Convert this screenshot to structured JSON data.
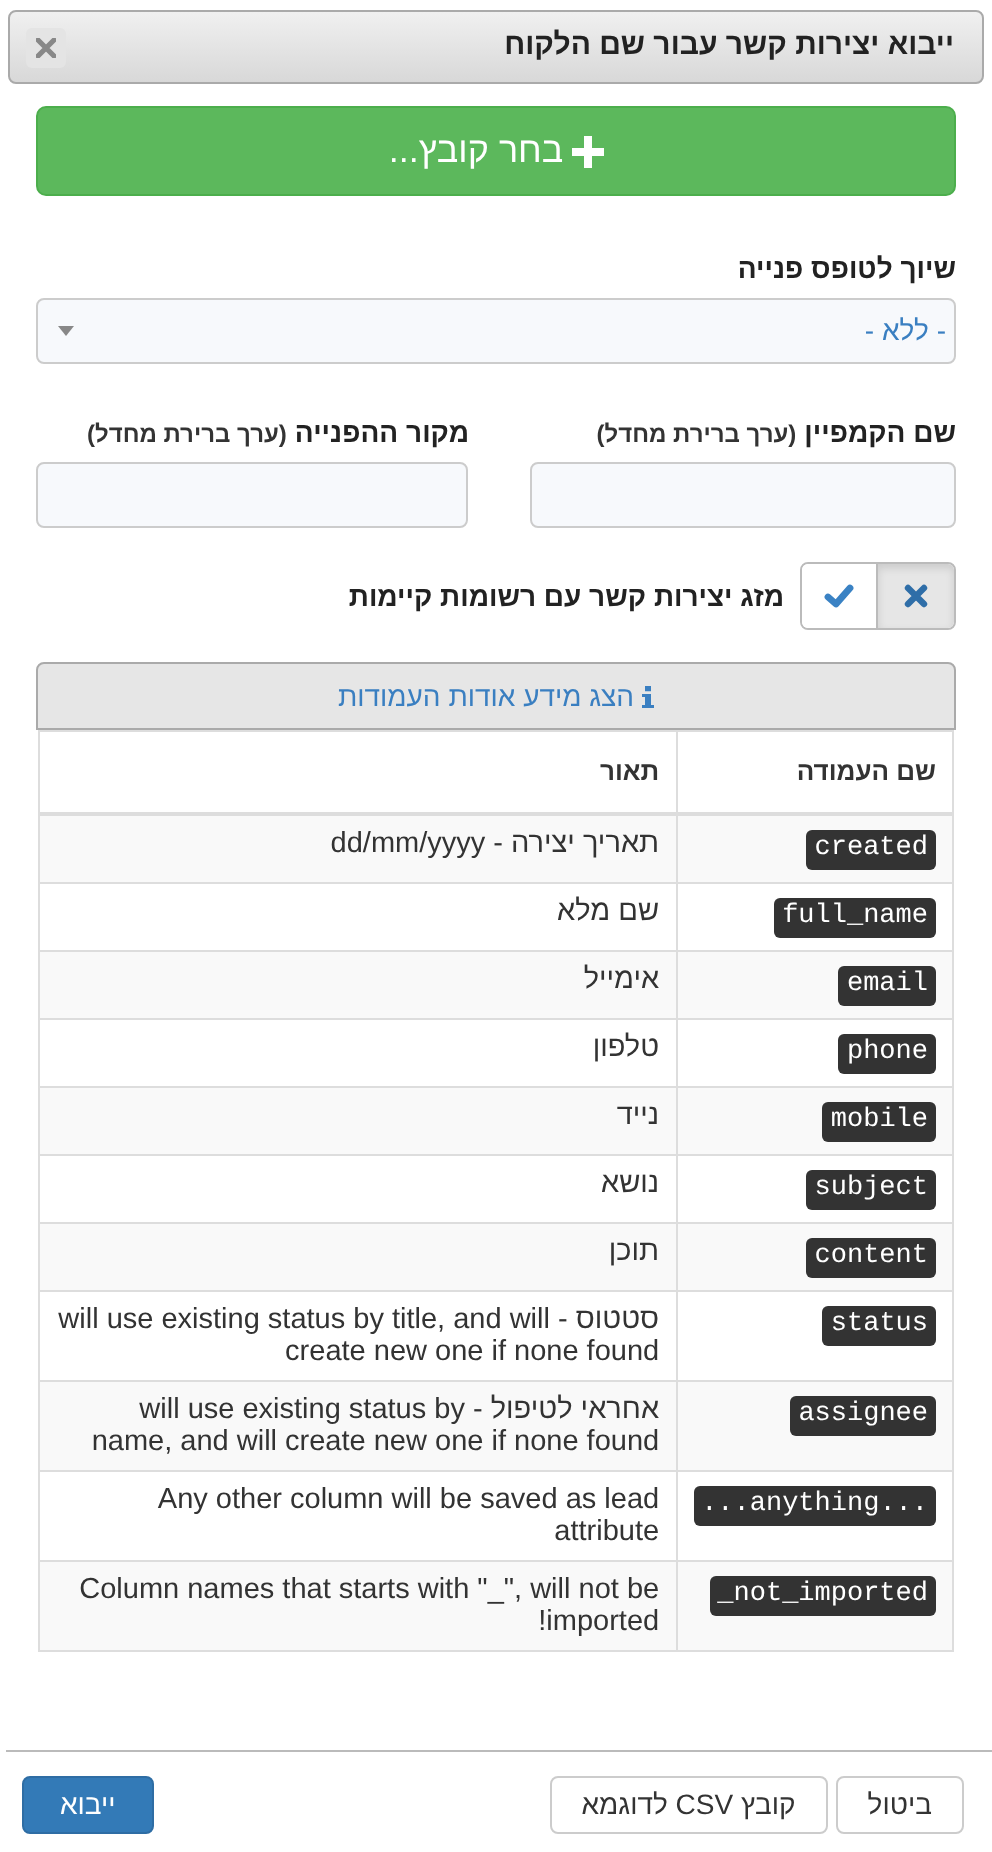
{
  "dialog": {
    "title": "ייבוא יצירות קשר עבור שם הלקוח"
  },
  "choose_file_button": {
    "label": "בחר קובץ..."
  },
  "form_type": {
    "label": "שיוך לטופס פנייה",
    "value": "- ללא -"
  },
  "fields": [
    {
      "label": "שם הקמפיין",
      "note": "(ערך ברירת מחדל)"
    },
    {
      "label": "מקור ההפנייה",
      "note": "(ערך ברירת מחדל)"
    }
  ],
  "merge": {
    "label": "מזג יצירות קשר עם רשומות קיימות",
    "on": false
  },
  "info_button": {
    "label": "הצג מידע אודות העמודות"
  },
  "table": {
    "columns": [
      "שם העמודה",
      "תאור"
    ],
    "rows": [
      {
        "name": "created",
        "description": "תאריך יצירה - dd/mm/yyyy"
      },
      {
        "name": "full_name",
        "description": "שם מלא"
      },
      {
        "name": "email",
        "description": "אימייל"
      },
      {
        "name": "phone",
        "description": "טלפון"
      },
      {
        "name": "mobile",
        "description": "נייד"
      },
      {
        "name": "subject",
        "description": "נושא"
      },
      {
        "name": "content",
        "description": "תוכן"
      },
      {
        "name": "status",
        "description": "סטטוס - will use existing status by title, and will create new one if none found"
      },
      {
        "name": "assignee",
        "description": "אחראי לטיפול - will use existing status by name, and will create new one if none found"
      },
      {
        "name": "...anything...",
        "description": "Any other column will be saved as lead attribute"
      },
      {
        "name": "_not_imported",
        "description": "Column names that starts with \"_\", will not be imported!"
      }
    ]
  },
  "footer_buttons": [
    {
      "label": "ביטול",
      "kind": "default"
    },
    {
      "label": "קובץ CSV לדוגמא",
      "kind": "default"
    },
    {
      "label": "ייבוא",
      "kind": "primary"
    }
  ]
}
